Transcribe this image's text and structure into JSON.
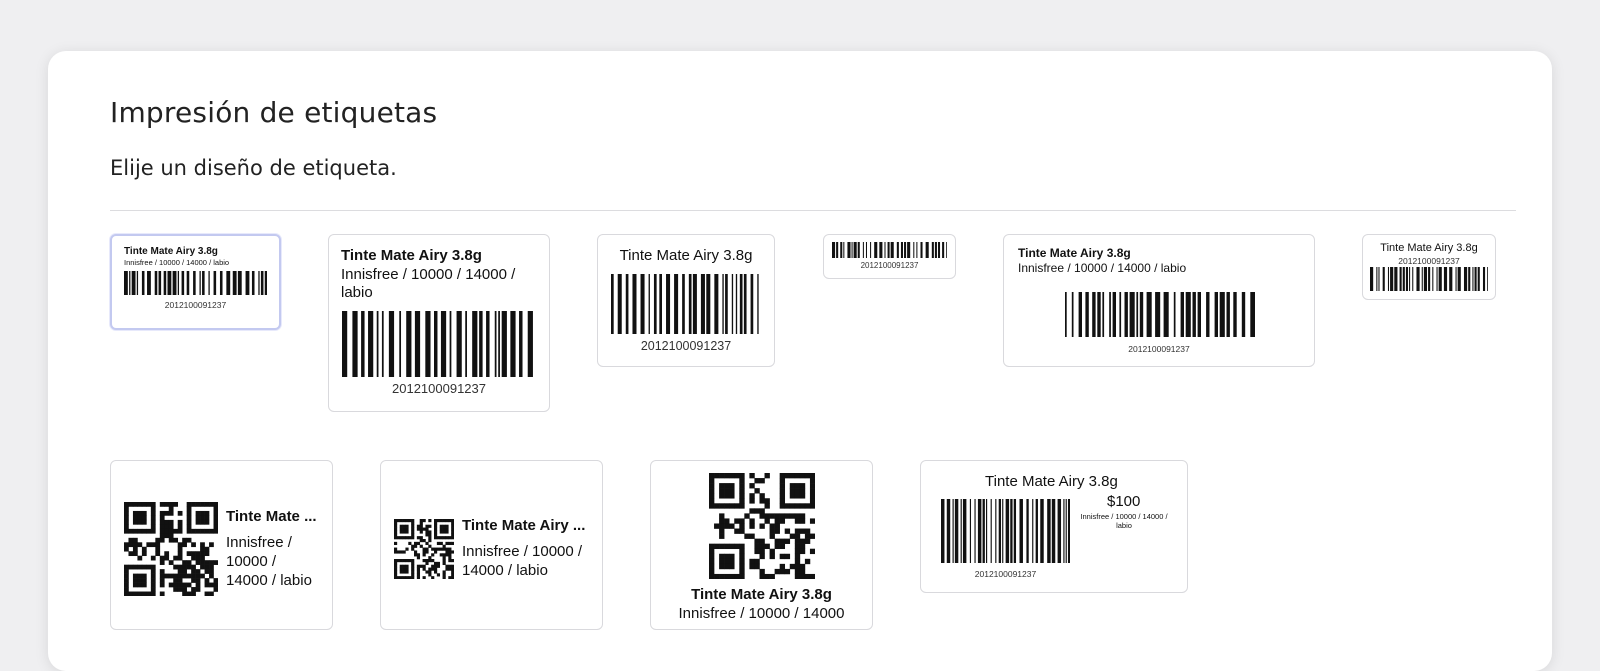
{
  "page": {
    "title": "Impresión de etiquetas",
    "subtitle": "Elije un diseño de etiqueta."
  },
  "label": {
    "product_name": "Tinte Mate Airy 3.8g",
    "product_name_truncated_short": "Tinte Mate ...",
    "product_name_truncated_long": "Tinte Mate Airy ...",
    "details": "Innisfree / 10000 / 14000 / labio",
    "details_line_a": "Innisfree / 10000 / 14000 /",
    "details_line_b": "labio",
    "details_q1_a": "Innisfree /",
    "details_q1_b": "10000 /",
    "details_q1_c": "14000 / labio",
    "details_q2_a": "Innisfree / 10000 /",
    "details_q2_b": "14000 / labio",
    "details_q3": "Innisfree / 10000 / 14000",
    "details_p_a": "Innisfree / 10000 / 14000 /",
    "details_p_b": "labio",
    "barcode_number": "2012100091237",
    "price": "$100"
  },
  "designs": [
    {
      "id": 1,
      "selected": true
    },
    {
      "id": 2,
      "selected": false
    },
    {
      "id": 3,
      "selected": false
    },
    {
      "id": 4,
      "selected": false
    },
    {
      "id": 5,
      "selected": false
    },
    {
      "id": 6,
      "selected": false
    },
    {
      "id": 7,
      "selected": false
    },
    {
      "id": 8,
      "selected": false
    },
    {
      "id": 9,
      "selected": false
    },
    {
      "id": 10,
      "selected": false
    }
  ],
  "colors": {
    "background": "#efeff1",
    "panel": "#ffffff",
    "card_border": "#d9d9dd",
    "selected_border": "#c3c9f0",
    "ink": "#111111"
  }
}
